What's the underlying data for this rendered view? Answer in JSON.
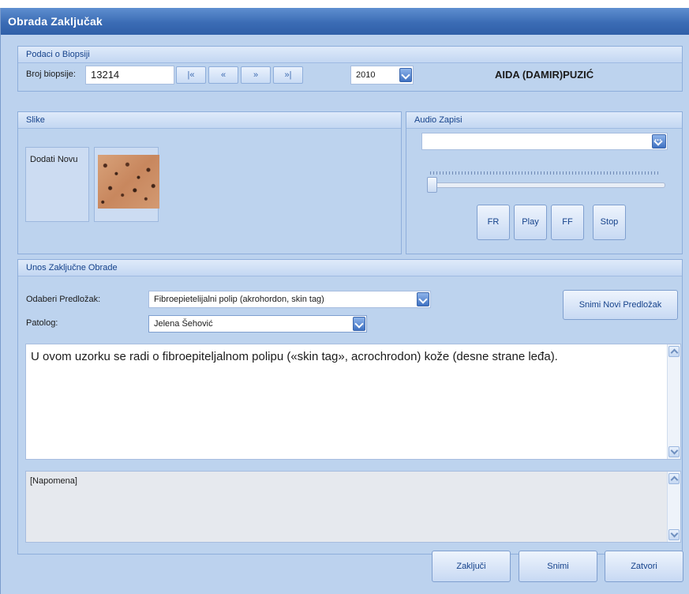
{
  "window": {
    "title": "Obrada Zaključak"
  },
  "biopsy_panel": {
    "header": "Podaci o Biopsiji",
    "number_label": "Broj biopsije:",
    "number_value": "13214",
    "nav": {
      "first": "|«",
      "prev": "«",
      "next": "»",
      "last": "»|"
    },
    "year_value": "2010",
    "patient_name": "AIDA (DAMIR)PUZIĆ"
  },
  "images_panel": {
    "header": "Slike",
    "add_new_label": "Dodati Novu"
  },
  "audio_panel": {
    "header": "Audio Zapisi",
    "browse_glyph": "...",
    "slider_position": 0,
    "buttons": {
      "rewind": "FR",
      "play": "Play",
      "fast_forward": "FF",
      "stop": "Stop"
    }
  },
  "conclusion_panel": {
    "header": "Unos Zaključne Obrade",
    "template_label": "Odaberi Predložak:",
    "template_value": "Fibroepietelijalni polip (akrohordon, skin tag)",
    "save_template_button": "Snimi Novi Predložak",
    "pathologist_label": "Patolog:",
    "pathologist_value": "Jelena Šehović",
    "conclusion_text": "U ovom uzorku se radi o fibroepiteljalnom polipu («skin tag», acrochrodon) kože (desne strane leđa).",
    "note_text": "[Napomena]"
  },
  "footer": {
    "conclude_button": "Zaključi",
    "save_button": "Snimi",
    "close_button": "Zatvori"
  }
}
